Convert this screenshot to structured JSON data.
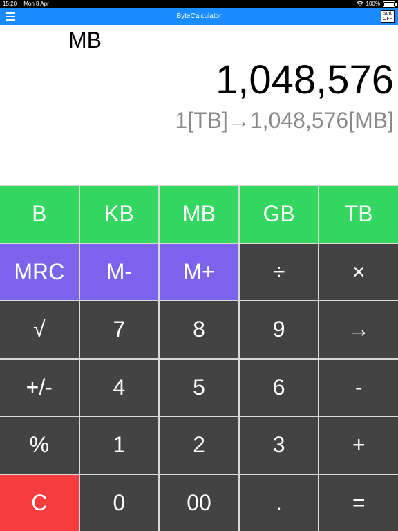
{
  "status": {
    "time": "15:20",
    "date": "Mon 8 Apr",
    "battery": "100%"
  },
  "nav": {
    "title": "ByteCalculator",
    "sort_line1": "sort",
    "sort_line2": "OFF"
  },
  "display": {
    "unit": "MB",
    "value": "1,048,576",
    "conversion": "1[TB]→1,048,576[MB]"
  },
  "keys": [
    {
      "label": "B",
      "color": "green",
      "name": "unit-b-key"
    },
    {
      "label": "KB",
      "color": "green",
      "name": "unit-kb-key"
    },
    {
      "label": "MB",
      "color": "green",
      "name": "unit-mb-key"
    },
    {
      "label": "GB",
      "color": "green",
      "name": "unit-gb-key"
    },
    {
      "label": "TB",
      "color": "green",
      "name": "unit-tb-key"
    },
    {
      "label": "MRC",
      "color": "purple",
      "name": "memory-recall-key"
    },
    {
      "label": "M-",
      "color": "purple",
      "name": "memory-minus-key"
    },
    {
      "label": "M+",
      "color": "purple",
      "name": "memory-plus-key"
    },
    {
      "label": "÷",
      "color": "dark",
      "name": "divide-key"
    },
    {
      "label": "×",
      "color": "dark",
      "name": "multiply-key"
    },
    {
      "label": "√",
      "color": "dark",
      "name": "sqrt-key"
    },
    {
      "label": "7",
      "color": "dark",
      "name": "digit-7-key"
    },
    {
      "label": "8",
      "color": "dark",
      "name": "digit-8-key"
    },
    {
      "label": "9",
      "color": "dark",
      "name": "digit-9-key"
    },
    {
      "label": "→",
      "color": "dark",
      "name": "convert-arrow-key"
    },
    {
      "label": "+/-",
      "color": "dark",
      "name": "sign-toggle-key"
    },
    {
      "label": "4",
      "color": "dark",
      "name": "digit-4-key"
    },
    {
      "label": "5",
      "color": "dark",
      "name": "digit-5-key"
    },
    {
      "label": "6",
      "color": "dark",
      "name": "digit-6-key"
    },
    {
      "label": "-",
      "color": "dark",
      "name": "minus-key"
    },
    {
      "label": "%",
      "color": "dark",
      "name": "percent-key"
    },
    {
      "label": "1",
      "color": "dark",
      "name": "digit-1-key"
    },
    {
      "label": "2",
      "color": "dark",
      "name": "digit-2-key"
    },
    {
      "label": "3",
      "color": "dark",
      "name": "digit-3-key"
    },
    {
      "label": "+",
      "color": "dark",
      "name": "plus-key"
    },
    {
      "label": "C",
      "color": "red",
      "name": "clear-key"
    },
    {
      "label": "0",
      "color": "dark",
      "name": "digit-0-key"
    },
    {
      "label": "00",
      "color": "dark",
      "name": "digit-00-key"
    },
    {
      "label": ".",
      "color": "dark",
      "name": "decimal-key"
    },
    {
      "label": "=",
      "color": "dark",
      "name": "equals-key"
    }
  ],
  "colors": {
    "green": "#34d760",
    "purple": "#7b63ec",
    "dark": "#434343",
    "red": "#f53d3f",
    "nav": "#1a8cff"
  },
  "icons": {
    "menu": "hamburger-menu-icon",
    "wifi": "wifi-icon",
    "battery": "battery-icon"
  }
}
